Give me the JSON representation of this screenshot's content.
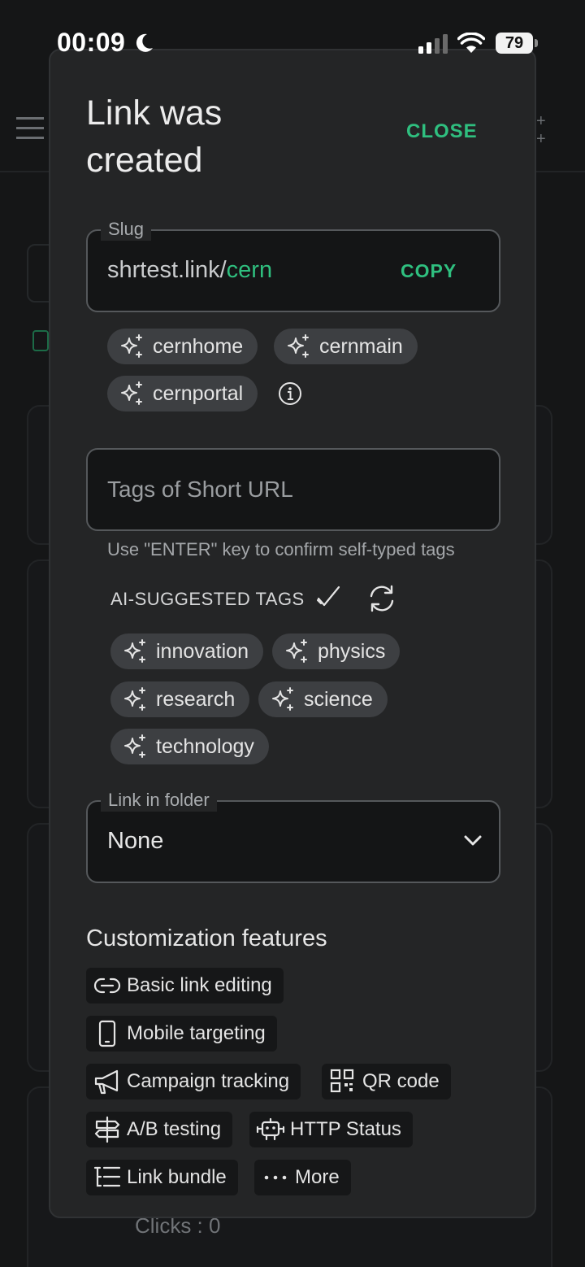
{
  "status_bar": {
    "time": "00:09",
    "battery": "79"
  },
  "background": {
    "clicks_text": "Clicks : 0"
  },
  "modal": {
    "title": "Link was created",
    "close_label": "CLOSE",
    "slug": {
      "legend": "Slug",
      "domain": "shrtest.link/",
      "value": "cern",
      "copy_label": "COPY",
      "suggestions": [
        "cernhome",
        "cernmain",
        "cernportal"
      ]
    },
    "tags": {
      "placeholder": "Tags of Short URL",
      "helper": "Use \"ENTER\" key to confirm self-typed tags",
      "ai_label": "AI-SUGGESTED TAGS",
      "suggestions": [
        "innovation",
        "physics",
        "research",
        "science",
        "technology"
      ]
    },
    "folder": {
      "legend": "Link in folder",
      "value": "None"
    },
    "customization": {
      "title": "Customization features",
      "features": [
        {
          "label": "Basic link editing",
          "icon": "link-icon"
        },
        {
          "label": "Mobile targeting",
          "icon": "mobile-icon"
        },
        {
          "label": "Campaign tracking",
          "icon": "megaphone-icon"
        },
        {
          "label": "QR code",
          "icon": "qr-code-icon"
        },
        {
          "label": "A/B testing",
          "icon": "signpost-icon"
        },
        {
          "label": "HTTP Status",
          "icon": "robot-icon"
        },
        {
          "label": "Link bundle",
          "icon": "list-tree-icon"
        },
        {
          "label": "More",
          "icon": "ellipsis-icon"
        }
      ]
    }
  },
  "colors": {
    "accent": "#2fbf7f",
    "modal_bg": "#242526",
    "chip_bg": "#3d3f42"
  }
}
